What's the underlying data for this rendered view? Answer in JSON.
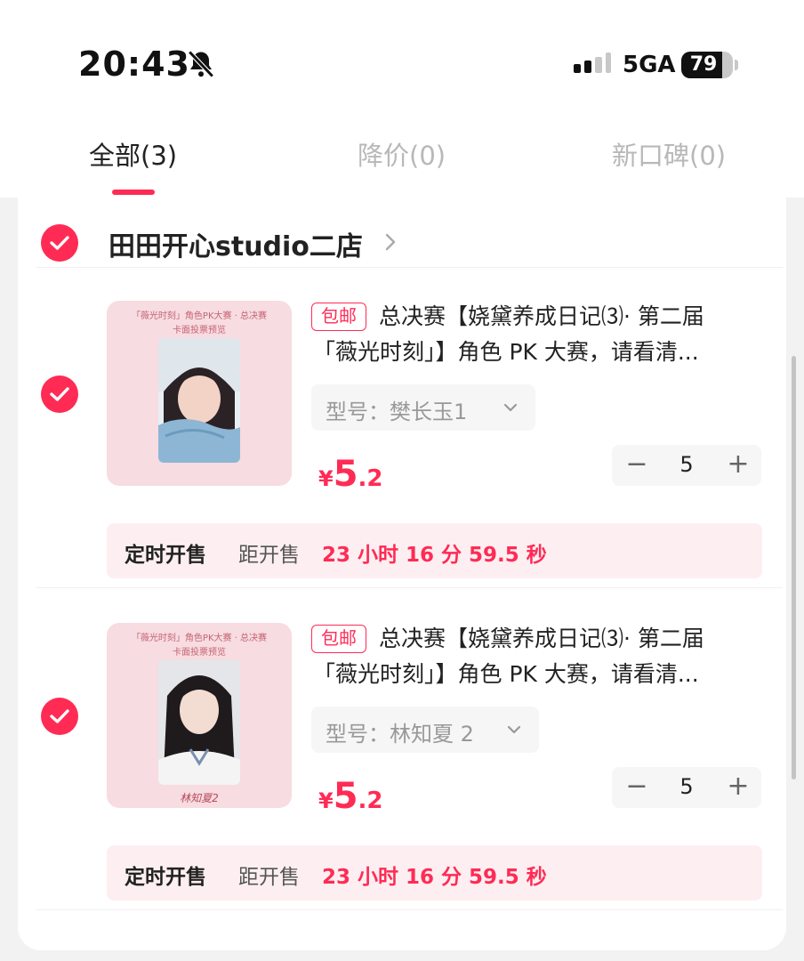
{
  "status_bar": {
    "time": "20:43",
    "network": "5GA",
    "battery": "79",
    "battery_level": 0.79
  },
  "tabs": [
    {
      "label": "全部(3)",
      "active": true
    },
    {
      "label": "降价(0)",
      "active": false
    },
    {
      "label": "新口碑(0)",
      "active": false
    }
  ],
  "shop": {
    "name": "田田开心studio二店"
  },
  "items": [
    {
      "badge": "包邮",
      "title_line1": "总决赛【娆黛养成日记⑶· 第二届",
      "title_line2": "「薇光时刻」】角色 PK 大赛，请看清...",
      "variant": "型号：樊长玉1",
      "price_symbol": "¥",
      "price_int": "5",
      "price_dec": ".2",
      "quantity": "5",
      "minus": "−",
      "plus": "+",
      "sale_label": "定时开售",
      "sale_dist": "距开售",
      "sale_countdown": "23 小时 16 分 59.5 秒",
      "thumb_caption1": "「薇光时刻」角色PK大赛 · 总决赛",
      "thumb_caption2": "卡面投票预览",
      "thumb_sign": ""
    },
    {
      "badge": "包邮",
      "title_line1": "总决赛【娆黛养成日记⑶· 第二届",
      "title_line2": "「薇光时刻」】角色 PK 大赛，请看清...",
      "variant": "型号：林知夏 2",
      "price_symbol": "¥",
      "price_int": "5",
      "price_dec": ".2",
      "quantity": "5",
      "minus": "−",
      "plus": "+",
      "sale_label": "定时开售",
      "sale_dist": "距开售",
      "sale_countdown": "23 小时 16 分 59.5 秒",
      "thumb_caption1": "「薇光时刻」角色PK大赛 · 总决赛",
      "thumb_caption2": "卡面投票预览",
      "thumb_sign": "林知夏2"
    }
  ],
  "colors": {
    "accent": "#ff2b55",
    "sale_bg": "#fdeff1",
    "thumb_bg": "#f7dce1"
  }
}
